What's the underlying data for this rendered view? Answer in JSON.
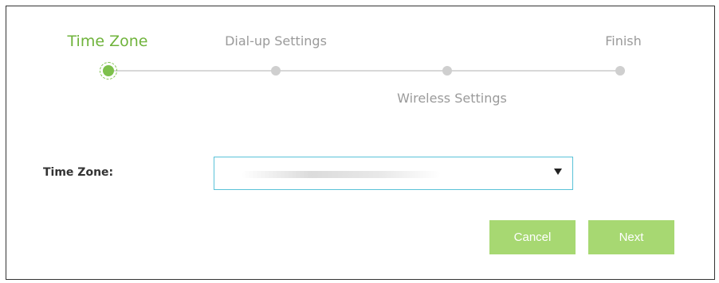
{
  "wizard": {
    "steps": [
      {
        "label": "Time Zone",
        "state": "active"
      },
      {
        "label": "Dial-up Settings",
        "state": "pending"
      },
      {
        "label": "Wireless Settings",
        "state": "pending"
      },
      {
        "label": "Finish",
        "state": "pending"
      }
    ]
  },
  "form": {
    "time_zone_label": "Time Zone:",
    "time_zone_value": ""
  },
  "buttons": {
    "cancel": "Cancel",
    "next": "Next"
  },
  "colors": {
    "accent": "#7dc04b",
    "button": "#a7d872",
    "select_border": "#59c2d8"
  },
  "icons": {
    "dropdown": "caret-down-icon"
  }
}
